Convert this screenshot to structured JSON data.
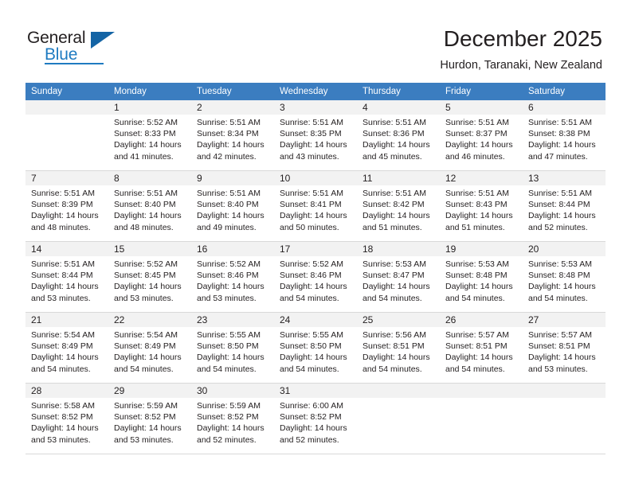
{
  "brand": {
    "name_top": "General",
    "name_bottom": "Blue",
    "triangle_icon": "triangle-icon",
    "accent_color": "#1f7bc1",
    "logo_dark_color": "#231f20"
  },
  "header": {
    "title": "December 2025",
    "subtitle": "Hurdon, Taranaki, New Zealand"
  },
  "calendar": {
    "header_background": "#3b7dc0",
    "daynum_band_background": "#f2f2f2",
    "weekday_headers": [
      "Sunday",
      "Monday",
      "Tuesday",
      "Wednesday",
      "Thursday",
      "Friday",
      "Saturday"
    ],
    "weeks": [
      {
        "days": [
          {
            "date": "",
            "lines": []
          },
          {
            "date": "1",
            "lines": [
              "Sunrise: 5:52 AM",
              "Sunset: 8:33 PM",
              "Daylight: 14 hours",
              "and 41 minutes."
            ]
          },
          {
            "date": "2",
            "lines": [
              "Sunrise: 5:51 AM",
              "Sunset: 8:34 PM",
              "Daylight: 14 hours",
              "and 42 minutes."
            ]
          },
          {
            "date": "3",
            "lines": [
              "Sunrise: 5:51 AM",
              "Sunset: 8:35 PM",
              "Daylight: 14 hours",
              "and 43 minutes."
            ]
          },
          {
            "date": "4",
            "lines": [
              "Sunrise: 5:51 AM",
              "Sunset: 8:36 PM",
              "Daylight: 14 hours",
              "and 45 minutes."
            ]
          },
          {
            "date": "5",
            "lines": [
              "Sunrise: 5:51 AM",
              "Sunset: 8:37 PM",
              "Daylight: 14 hours",
              "and 46 minutes."
            ]
          },
          {
            "date": "6",
            "lines": [
              "Sunrise: 5:51 AM",
              "Sunset: 8:38 PM",
              "Daylight: 14 hours",
              "and 47 minutes."
            ]
          }
        ]
      },
      {
        "days": [
          {
            "date": "7",
            "lines": [
              "Sunrise: 5:51 AM",
              "Sunset: 8:39 PM",
              "Daylight: 14 hours",
              "and 48 minutes."
            ]
          },
          {
            "date": "8",
            "lines": [
              "Sunrise: 5:51 AM",
              "Sunset: 8:40 PM",
              "Daylight: 14 hours",
              "and 48 minutes."
            ]
          },
          {
            "date": "9",
            "lines": [
              "Sunrise: 5:51 AM",
              "Sunset: 8:40 PM",
              "Daylight: 14 hours",
              "and 49 minutes."
            ]
          },
          {
            "date": "10",
            "lines": [
              "Sunrise: 5:51 AM",
              "Sunset: 8:41 PM",
              "Daylight: 14 hours",
              "and 50 minutes."
            ]
          },
          {
            "date": "11",
            "lines": [
              "Sunrise: 5:51 AM",
              "Sunset: 8:42 PM",
              "Daylight: 14 hours",
              "and 51 minutes."
            ]
          },
          {
            "date": "12",
            "lines": [
              "Sunrise: 5:51 AM",
              "Sunset: 8:43 PM",
              "Daylight: 14 hours",
              "and 51 minutes."
            ]
          },
          {
            "date": "13",
            "lines": [
              "Sunrise: 5:51 AM",
              "Sunset: 8:44 PM",
              "Daylight: 14 hours",
              "and 52 minutes."
            ]
          }
        ]
      },
      {
        "days": [
          {
            "date": "14",
            "lines": [
              "Sunrise: 5:51 AM",
              "Sunset: 8:44 PM",
              "Daylight: 14 hours",
              "and 53 minutes."
            ]
          },
          {
            "date": "15",
            "lines": [
              "Sunrise: 5:52 AM",
              "Sunset: 8:45 PM",
              "Daylight: 14 hours",
              "and 53 minutes."
            ]
          },
          {
            "date": "16",
            "lines": [
              "Sunrise: 5:52 AM",
              "Sunset: 8:46 PM",
              "Daylight: 14 hours",
              "and 53 minutes."
            ]
          },
          {
            "date": "17",
            "lines": [
              "Sunrise: 5:52 AM",
              "Sunset: 8:46 PM",
              "Daylight: 14 hours",
              "and 54 minutes."
            ]
          },
          {
            "date": "18",
            "lines": [
              "Sunrise: 5:53 AM",
              "Sunset: 8:47 PM",
              "Daylight: 14 hours",
              "and 54 minutes."
            ]
          },
          {
            "date": "19",
            "lines": [
              "Sunrise: 5:53 AM",
              "Sunset: 8:48 PM",
              "Daylight: 14 hours",
              "and 54 minutes."
            ]
          },
          {
            "date": "20",
            "lines": [
              "Sunrise: 5:53 AM",
              "Sunset: 8:48 PM",
              "Daylight: 14 hours",
              "and 54 minutes."
            ]
          }
        ]
      },
      {
        "days": [
          {
            "date": "21",
            "lines": [
              "Sunrise: 5:54 AM",
              "Sunset: 8:49 PM",
              "Daylight: 14 hours",
              "and 54 minutes."
            ]
          },
          {
            "date": "22",
            "lines": [
              "Sunrise: 5:54 AM",
              "Sunset: 8:49 PM",
              "Daylight: 14 hours",
              "and 54 minutes."
            ]
          },
          {
            "date": "23",
            "lines": [
              "Sunrise: 5:55 AM",
              "Sunset: 8:50 PM",
              "Daylight: 14 hours",
              "and 54 minutes."
            ]
          },
          {
            "date": "24",
            "lines": [
              "Sunrise: 5:55 AM",
              "Sunset: 8:50 PM",
              "Daylight: 14 hours",
              "and 54 minutes."
            ]
          },
          {
            "date": "25",
            "lines": [
              "Sunrise: 5:56 AM",
              "Sunset: 8:51 PM",
              "Daylight: 14 hours",
              "and 54 minutes."
            ]
          },
          {
            "date": "26",
            "lines": [
              "Sunrise: 5:57 AM",
              "Sunset: 8:51 PM",
              "Daylight: 14 hours",
              "and 54 minutes."
            ]
          },
          {
            "date": "27",
            "lines": [
              "Sunrise: 5:57 AM",
              "Sunset: 8:51 PM",
              "Daylight: 14 hours",
              "and 53 minutes."
            ]
          }
        ]
      },
      {
        "days": [
          {
            "date": "28",
            "lines": [
              "Sunrise: 5:58 AM",
              "Sunset: 8:52 PM",
              "Daylight: 14 hours",
              "and 53 minutes."
            ]
          },
          {
            "date": "29",
            "lines": [
              "Sunrise: 5:59 AM",
              "Sunset: 8:52 PM",
              "Daylight: 14 hours",
              "and 53 minutes."
            ]
          },
          {
            "date": "30",
            "lines": [
              "Sunrise: 5:59 AM",
              "Sunset: 8:52 PM",
              "Daylight: 14 hours",
              "and 52 minutes."
            ]
          },
          {
            "date": "31",
            "lines": [
              "Sunrise: 6:00 AM",
              "Sunset: 8:52 PM",
              "Daylight: 14 hours",
              "and 52 minutes."
            ]
          },
          {
            "date": "",
            "lines": []
          },
          {
            "date": "",
            "lines": []
          },
          {
            "date": "",
            "lines": []
          }
        ]
      }
    ]
  }
}
